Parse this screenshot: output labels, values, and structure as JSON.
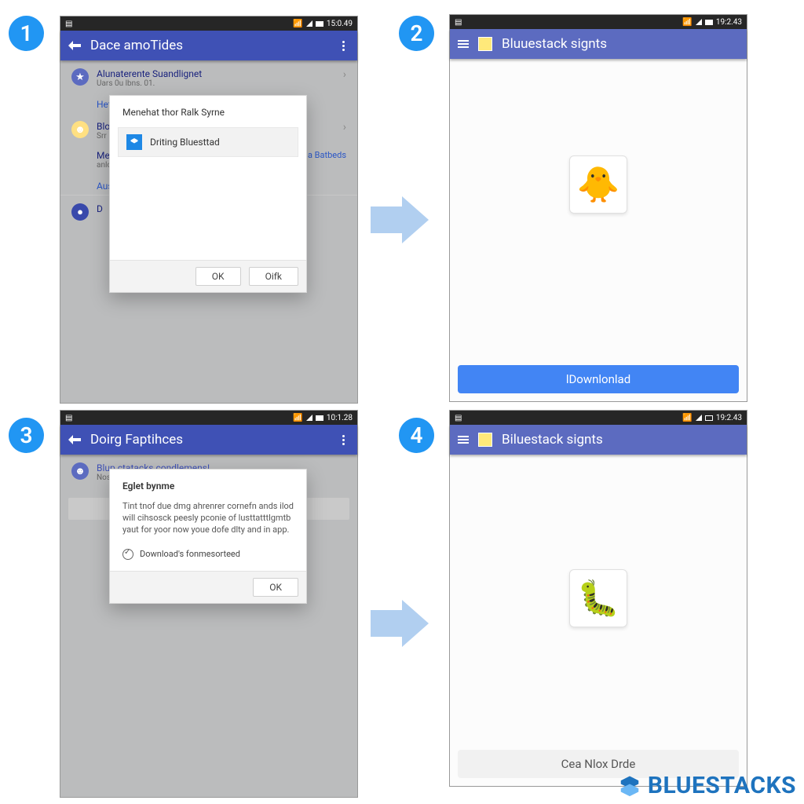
{
  "badges": {
    "s1": "1",
    "s2": "2",
    "s3": "3",
    "s4": "4"
  },
  "status": {
    "wifi_glyph": "📶",
    "t1": "15:0.49",
    "t2": "19:2.43",
    "t3": "10:1.28",
    "t4": "19:2.43"
  },
  "step1": {
    "title": "Dace amoTides",
    "item1": {
      "title": "Alunaterente Suandlignet",
      "sub": "Uars 0u lbns. 01."
    },
    "link1": "Hetll",
    "item2": {
      "title": "Blox",
      "sub": "Srr"
    },
    "item3": {
      "title": "Meju",
      "sub": "anlor"
    },
    "link2": "Auss",
    "pill": "D",
    "side": "a Batbeds",
    "dialog": {
      "title": "Menehat thor Ralk Syrne",
      "row": "Driting Bluesttad",
      "ok": "OK",
      "alt": "Oifk"
    }
  },
  "step2": {
    "title": "Bluuestack signts",
    "icon_glyph": "🐥",
    "download": "lDownlonlad"
  },
  "step3": {
    "title": "Doirg Faptihces",
    "head": {
      "title": "Blup ctatacks condlemens!",
      "sub": "Nosil"
    },
    "dialog": {
      "title": "Eglet bynme",
      "body": "Tint tnof due dmg ahrenrer cornefn ands ilod will cihsosck peesly pconie of lusttatttlgmtb yaut for yoor now youe dofe dlty and in app.",
      "check": "Download's fonmesorteed",
      "ok": "OK"
    }
  },
  "step4": {
    "title": "Biluestack signts",
    "icon_glyph": "🐛",
    "action": "Cea Nlox Drde"
  },
  "brand": "BLUESTACKS"
}
